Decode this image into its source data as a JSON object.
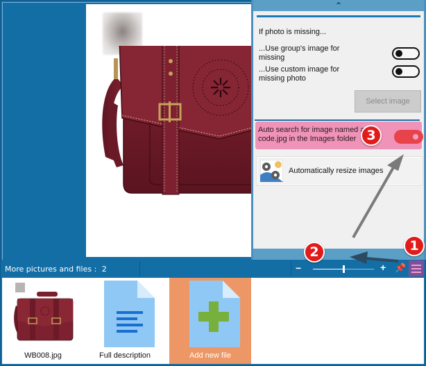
{
  "panel": {
    "collapse_up_icon": "chevron-up",
    "heading": "If photo is missing...",
    "options": [
      {
        "label": "...Use group's image for missing",
        "enabled": false
      },
      {
        "label": "...Use custom image for missing photo",
        "enabled": false
      }
    ],
    "select_image_label": "Select image",
    "auto_search": {
      "label": "Auto search for image named a code.jpg in the Images folder",
      "enabled": true
    },
    "resize": {
      "label": "Automatically resize images",
      "icon": "settings-image-icon"
    },
    "collapse_down_icon": "chevron-down"
  },
  "status_bar": {
    "label": "More pictures and files :",
    "count": "2",
    "zoom_minus": "−",
    "zoom_plus": "+",
    "zoom_level": 0.5,
    "pin_icon": "pin-icon",
    "menu_icon": "hamburger-menu-icon"
  },
  "files": [
    {
      "name": "WB008.jpg",
      "type": "image"
    },
    {
      "name": "Full description",
      "type": "document"
    },
    {
      "name": "Add new file",
      "type": "add"
    }
  ],
  "annotations": [
    {
      "number": "1",
      "target": "menu-button"
    },
    {
      "number": "2",
      "target": "panel-collapse-toggle"
    },
    {
      "number": "3",
      "target": "auto-search-toggle"
    }
  ],
  "colors": {
    "frame_blue": "#136ea6",
    "panel_bar": "#5b9fc7",
    "highlight_pink": "#ef93b8",
    "toggle_on_red": "#e8424a",
    "menu_purple": "#7b4f9d",
    "add_orange": "#ed9766",
    "badge_red": "#e11a1a"
  }
}
